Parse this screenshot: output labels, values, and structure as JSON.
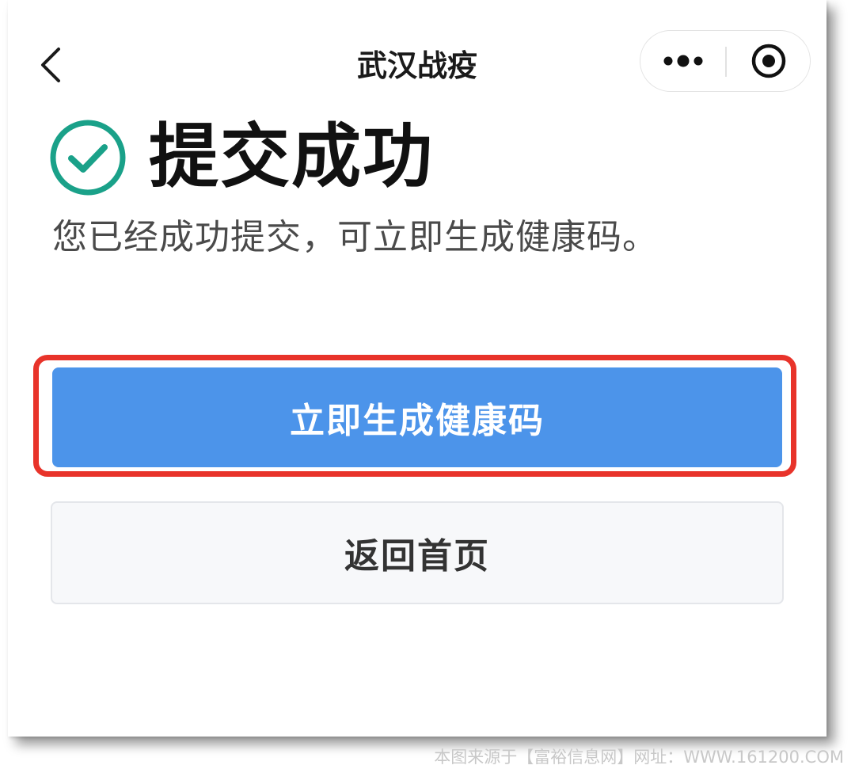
{
  "nav": {
    "title": "武汉战疫",
    "icons": {
      "back": "chevron-left-icon",
      "more": "more-dots-icon",
      "close": "target-close-icon"
    }
  },
  "result": {
    "icon": "check-circle-icon",
    "title": "提交成功",
    "description": "您已经成功提交，可立即生成健康码。"
  },
  "actions": {
    "primary_label": "立即生成健康码",
    "secondary_label": "返回首页"
  },
  "watermark": "本图来源于【富裕信息网】网址：WWW.161200.COM",
  "colors": {
    "primary": "#4c94ea",
    "success": "#1aa189",
    "highlight": "#e8332a"
  }
}
